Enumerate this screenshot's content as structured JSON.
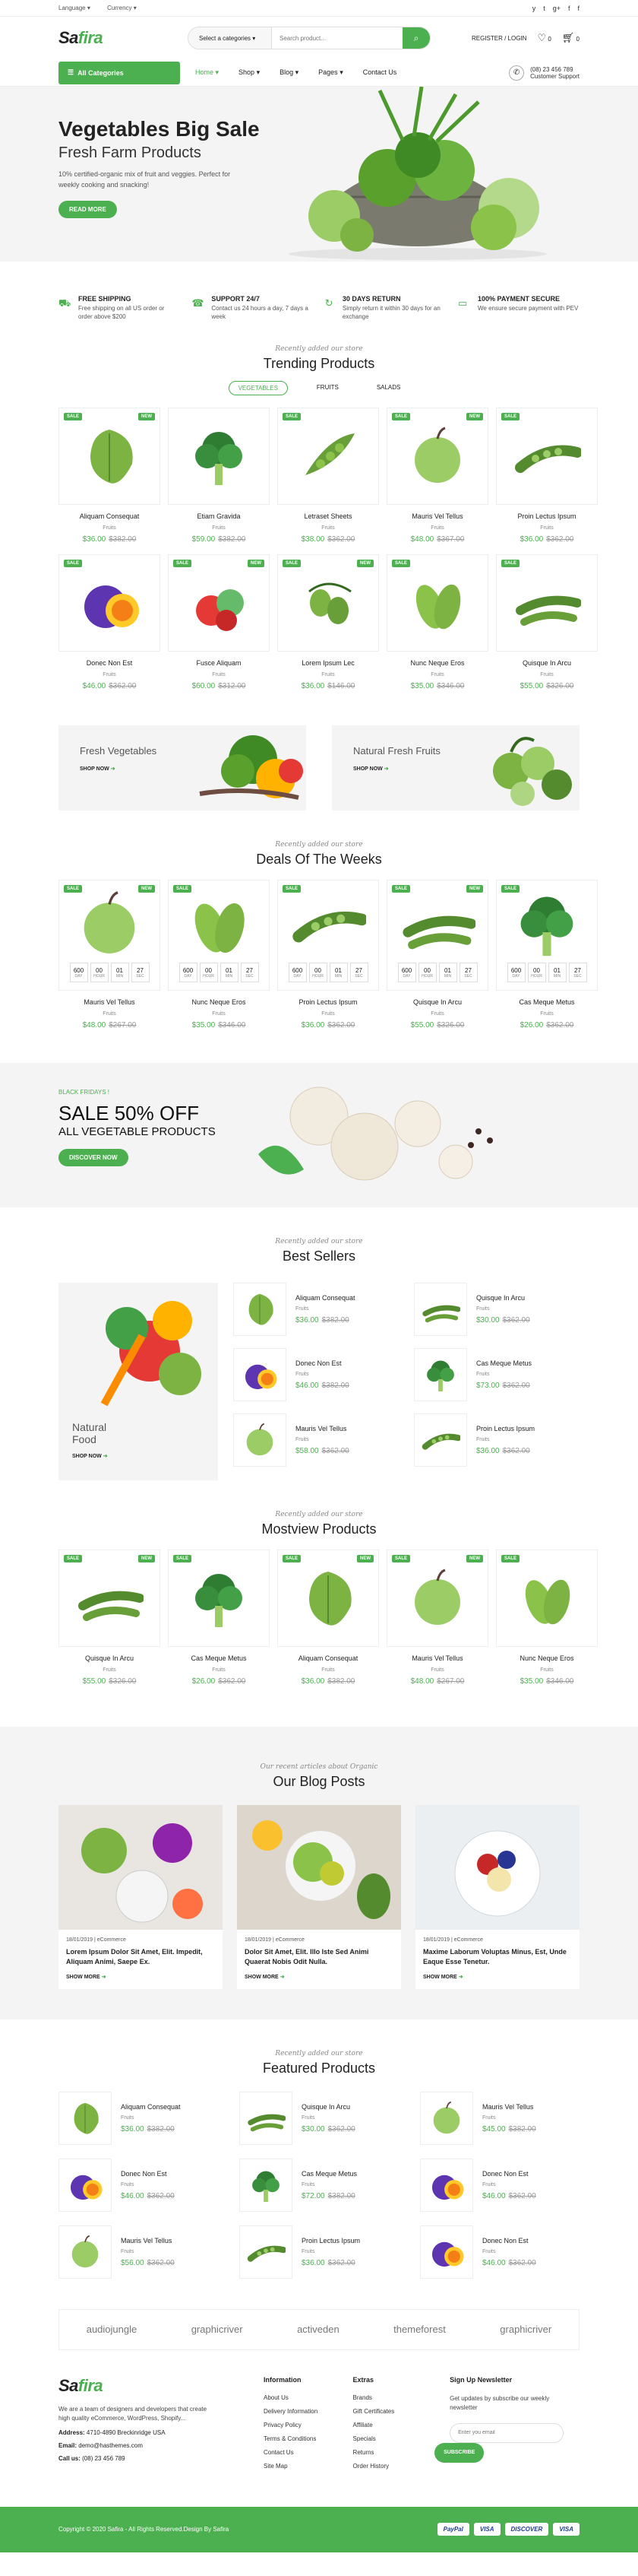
{
  "topbar": {
    "language": "Language",
    "currency": "Currency",
    "social": [
      "y",
      "t",
      "g+",
      "f",
      "f"
    ]
  },
  "header": {
    "logo_a": "Sa",
    "logo_b": "fira",
    "search_cat": "Select a categories",
    "search_placeholder": "Search product...",
    "register": "REGISTER / LOGIN",
    "wish_count": "0",
    "cart_count": "0"
  },
  "nav": {
    "all": "All Categories",
    "links": [
      "Home",
      "Shop",
      "Blog",
      "Pages",
      "Contact Us"
    ],
    "phone": "(08) 23 456 789",
    "support": "Customer Support"
  },
  "hero": {
    "title": "Vegetables Big Sale",
    "subtitle": "Fresh Farm Products",
    "text": "10% certified-organic mix of fruit and veggies. Perfect for weekly cooking and snacking!",
    "button": "READ MORE"
  },
  "features": [
    {
      "title": "FREE SHIPPING",
      "text": "Free shipping on all US order or order above $200"
    },
    {
      "title": "SUPPORT 24/7",
      "text": "Contact us 24 hours a day, 7 days a week"
    },
    {
      "title": "30 DAYS RETURN",
      "text": "Simply return it within 30 days for an exchange"
    },
    {
      "title": "100% PAYMENT SECURE",
      "text": "We ensure secure payment with PEV"
    }
  ],
  "trending": {
    "pre": "Recently added our store",
    "title": "Trending Products",
    "tabs": [
      "VEGETABLES",
      "FRUITS",
      "SALADS"
    ],
    "items": [
      {
        "name": "Aliquam Consequat",
        "cat": "Fruits",
        "price": "$36.00",
        "old": "$382.00",
        "l": "SALE",
        "r": "NEW"
      },
      {
        "name": "Etiam Gravida",
        "cat": "Fruits",
        "price": "$59.00",
        "old": "$382.00",
        "l": "",
        "r": ""
      },
      {
        "name": "Letraset Sheets",
        "cat": "Fruits",
        "price": "$38.00",
        "old": "$362.00",
        "l": "SALE",
        "r": ""
      },
      {
        "name": "Mauris Vel Tellus",
        "cat": "Fruits",
        "price": "$48.00",
        "old": "$367.00",
        "l": "SALE",
        "r": "NEW"
      },
      {
        "name": "Proin Lectus Ipsum",
        "cat": "Fruits",
        "price": "$36.00",
        "old": "$362.00",
        "l": "SALE",
        "r": ""
      },
      {
        "name": "Donec Non Est",
        "cat": "Fruits",
        "price": "$46.00",
        "old": "$362.00",
        "l": "SALE",
        "r": ""
      },
      {
        "name": "Fusce Aliquam",
        "cat": "Fruits",
        "price": "$60.00",
        "old": "$312.00",
        "l": "SALE",
        "r": "NEW"
      },
      {
        "name": "Lorem Ipsum Lec",
        "cat": "Fruits",
        "price": "$36.00",
        "old": "$146.00",
        "l": "SALE",
        "r": "NEW"
      },
      {
        "name": "Nunc Neque Eros",
        "cat": "Fruits",
        "price": "$35.00",
        "old": "$346.00",
        "l": "SALE",
        "r": ""
      },
      {
        "name": "Quisque In Arcu",
        "cat": "Fruits",
        "price": "$55.00",
        "old": "$326.00",
        "l": "SALE",
        "r": ""
      }
    ]
  },
  "banners": [
    {
      "title": "Fresh Vegetables",
      "link": "SHOP NOW"
    },
    {
      "title": "Natural Fresh Fruits",
      "link": "SHOP NOW"
    }
  ],
  "deals": {
    "pre": "Recently added our store",
    "title": "Deals Of The Weeks",
    "labels": [
      "DAY",
      "HOUR",
      "MIN",
      "SEC"
    ],
    "items": [
      {
        "name": "Mauris Vel Tellus",
        "cat": "Fruits",
        "price": "$48.00",
        "old": "$267.00",
        "l": "SALE",
        "r": "NEW",
        "cd": [
          "600",
          "00",
          "01",
          "27"
        ]
      },
      {
        "name": "Nunc Neque Eros",
        "cat": "Fruits",
        "price": "$35.00",
        "old": "$346.00",
        "l": "SALE",
        "r": "",
        "cd": [
          "600",
          "00",
          "01",
          "27"
        ]
      },
      {
        "name": "Proin Lectus Ipsum",
        "cat": "Fruits",
        "price": "$36.00",
        "old": "$362.00",
        "l": "SALE",
        "r": "",
        "cd": [
          "600",
          "00",
          "01",
          "27"
        ]
      },
      {
        "name": "Quisque In Arcu",
        "cat": "Fruits",
        "price": "$55.00",
        "old": "$326.00",
        "l": "SALE",
        "r": "NEW",
        "cd": [
          "600",
          "00",
          "01",
          "27"
        ]
      },
      {
        "name": "Cas Meque Metus",
        "cat": "Fruits",
        "price": "$26.00",
        "old": "$362.00",
        "l": "SALE",
        "r": "",
        "cd": [
          "600",
          "00",
          "01",
          "27"
        ]
      }
    ]
  },
  "sale": {
    "pre": "BLACK FRIDAYS !",
    "title": "SALE 50% OFF",
    "sub": "ALL VEGETABLE PRODUCTS",
    "button": "DISCOVER NOW"
  },
  "bestsellers": {
    "pre": "Recently added our store",
    "title": "Best Sellers",
    "banner": "Natural",
    "banner2": "Food",
    "link": "SHOP NOW",
    "cols": [
      [
        {
          "name": "Aliquam Consequat",
          "cat": "Fruits",
          "price": "$36.00",
          "old": "$382.00"
        },
        {
          "name": "Donec Non Est",
          "cat": "Fruits",
          "price": "$46.00",
          "old": "$382.00"
        },
        {
          "name": "Mauris Vel Tellus",
          "cat": "Fruits",
          "price": "$58.00",
          "old": "$362.00"
        }
      ],
      [
        {
          "name": "Quisque In Arcu",
          "cat": "Fruits",
          "price": "$30.00",
          "old": "$362.00"
        },
        {
          "name": "Cas Meque Metus",
          "cat": "Fruits",
          "price": "$73.00",
          "old": "$362.00"
        },
        {
          "name": "Proin Lectus Ipsum",
          "cat": "Fruits",
          "price": "$36.00",
          "old": "$362.00"
        }
      ]
    ]
  },
  "mostview": {
    "pre": "Recently added our store",
    "title": "Mostview Products",
    "items": [
      {
        "name": "Quisque In Arcu",
        "cat": "Fruits",
        "price": "$55.00",
        "old": "$326.00",
        "l": "SALE",
        "r": "NEW"
      },
      {
        "name": "Cas Meque Metus",
        "cat": "Fruits",
        "price": "$26.00",
        "old": "$362.00",
        "l": "SALE",
        "r": ""
      },
      {
        "name": "Aliquam Consequat",
        "cat": "Fruits",
        "price": "$36.00",
        "old": "$382.00",
        "l": "SALE",
        "r": "NEW"
      },
      {
        "name": "Mauris Vel Tellus",
        "cat": "Fruits",
        "price": "$48.00",
        "old": "$267.00",
        "l": "SALE",
        "r": "NEW"
      },
      {
        "name": "Nunc Neque Eros",
        "cat": "Fruits",
        "price": "$35.00",
        "old": "$346.00",
        "l": "SALE",
        "r": ""
      }
    ]
  },
  "blog": {
    "pre": "Our recent articles about Organic",
    "title": "Our Blog Posts",
    "more": "SHOW MORE",
    "posts": [
      {
        "date": "18/01/2019 | eCommerce",
        "title": "Lorem Ipsum Dolor Sit Amet, Elit. Impedit, Aliquam Animi, Saepe Ex."
      },
      {
        "date": "18/01/2019 | eCommerce",
        "title": "Dolor Sit Amet, Elit. Illo Iste Sed Animi Quaerat Nobis Odit Nulla."
      },
      {
        "date": "18/01/2019 | eCommerce",
        "title": "Maxime Laborum Voluptas Minus, Est, Unde Eaque Esse Tenetur."
      }
    ]
  },
  "featured": {
    "pre": "Recently added our store",
    "title": "Featured Products",
    "items": [
      {
        "name": "Aliquam Consequat",
        "cat": "Fruits",
        "price": "$36.00",
        "old": "$382.00"
      },
      {
        "name": "Quisque In Arcu",
        "cat": "Fruits",
        "price": "$30.00",
        "old": "$362.00"
      },
      {
        "name": "Mauris Vel Tellus",
        "cat": "Fruits",
        "price": "$45.00",
        "old": "$382.00"
      },
      {
        "name": "Donec Non Est",
        "cat": "Fruits",
        "price": "$46.00",
        "old": "$362.00"
      },
      {
        "name": "Cas Meque Metus",
        "cat": "Fruits",
        "price": "$72.00",
        "old": "$382.00"
      },
      {
        "name": "Donec Non Est",
        "cat": "Fruits",
        "price": "$46.00",
        "old": "$362.00"
      },
      {
        "name": "Mauris Vel Tellus",
        "cat": "Fruits",
        "price": "$56.00",
        "old": "$362.00"
      },
      {
        "name": "Proin Lectus Ipsum",
        "cat": "Fruits",
        "price": "$36.00",
        "old": "$362.00"
      },
      {
        "name": "Donec Non Est",
        "cat": "Fruits",
        "price": "$46.00",
        "old": "$362.00"
      }
    ]
  },
  "brands": [
    "audiojungle",
    "graphicriver",
    "activeden",
    "themeforest",
    "graphicriver"
  ],
  "footer": {
    "about": "We are a team of designers and developers that create high quality eCommerce, WordPress, Shopify...",
    "address_l": "Address:",
    "address": "4710-4890 Breckinridge USA",
    "email_l": "Email:",
    "email": "demo@hasthemes.com",
    "call_l": "Call us:",
    "call": "(08) 23 456 789",
    "info_title": "Information",
    "info": [
      "About Us",
      "Delivery Information",
      "Privacy Policy",
      "Terms & Conditions",
      "Contact Us",
      "Site Map"
    ],
    "extras_title": "Extras",
    "extras": [
      "Brands",
      "Gift Certificates",
      "Affiliate",
      "Specials",
      "Returns",
      "Order History"
    ],
    "nl_title": "Sign Up Newsletter",
    "nl_text": "Get updates by subscribe our weekly newsletter",
    "nl_placeholder": "Enter you email",
    "nl_button": "SUBSCRIBE"
  },
  "copyright": "Copyright © 2020 Safira - All Rights Reserved.Design By Safira",
  "payments": [
    "PayPal",
    "VISA",
    "DISCOVER",
    "VISA"
  ],
  "colors": {
    "accent": "#4caf50"
  }
}
